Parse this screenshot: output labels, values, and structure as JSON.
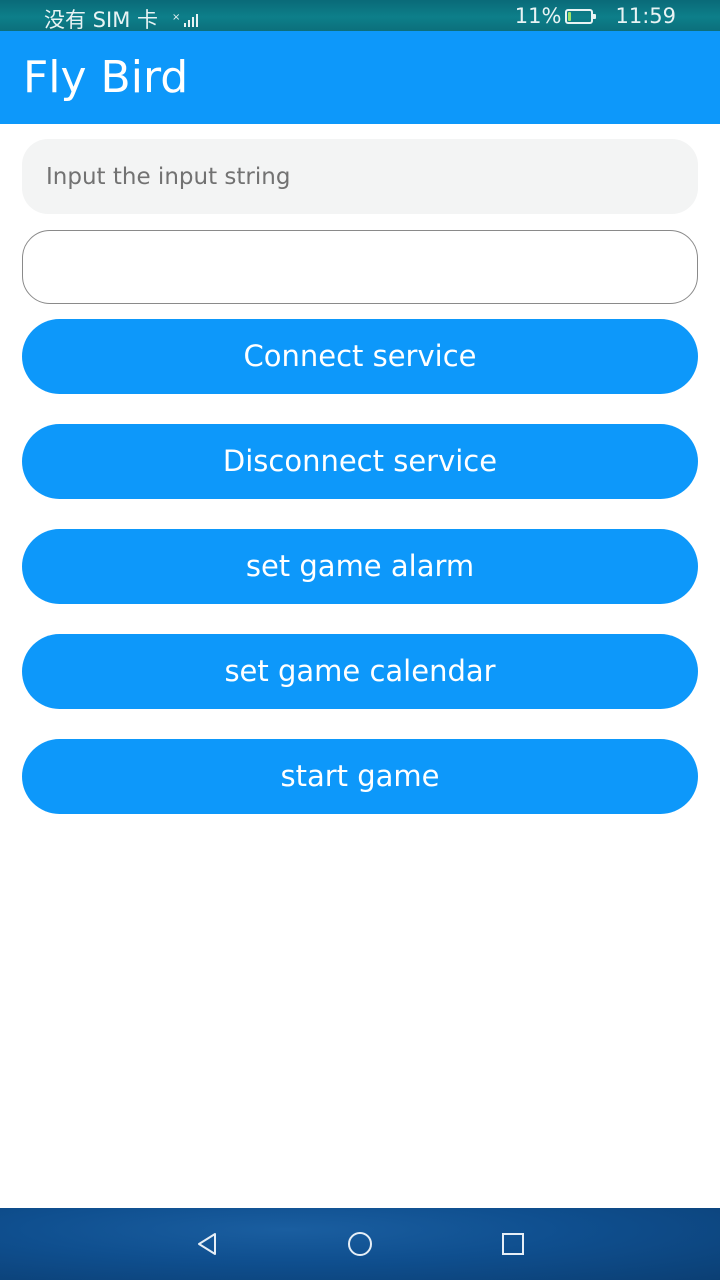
{
  "status_bar": {
    "carrier": "没有 SIM 卡",
    "battery_percent_text": "11%",
    "battery_level": 0.11,
    "time": "11:59"
  },
  "app_bar": {
    "title": "Fly Bird"
  },
  "main": {
    "input": {
      "placeholder": "Input the input string",
      "value": ""
    },
    "output_text": "",
    "buttons": {
      "connect": "Connect service",
      "disconnect": "Disconnect service",
      "set_alarm": "set game alarm",
      "set_calendar": "set game calendar",
      "start_game": "start game"
    }
  },
  "nav_bar": {
    "icons": [
      "back-icon",
      "home-icon",
      "recent-apps-icon"
    ]
  },
  "colors": {
    "accent": "#0d98fa",
    "status_bar": "#0d7f8a",
    "input_bg": "#f3f4f4",
    "nav_bar": "#0f4f8f"
  }
}
